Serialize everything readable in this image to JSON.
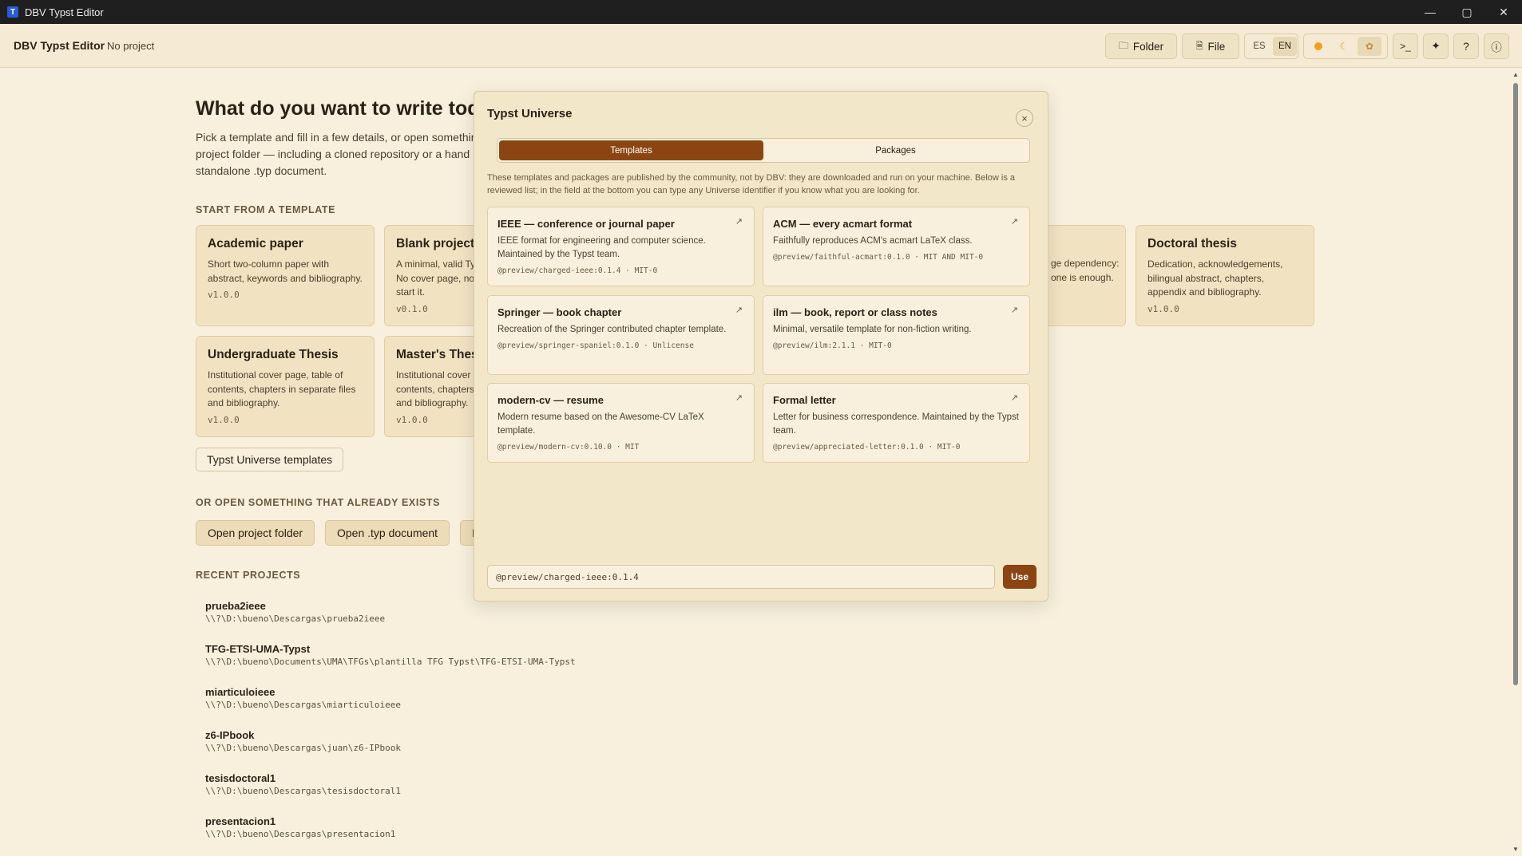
{
  "window": {
    "title": "DBV Typst Editor",
    "icon_letter": "T",
    "controls": [
      "minimize-icon",
      "maximize-icon",
      "close-icon"
    ]
  },
  "header": {
    "brand": "DBV Typst Editor",
    "project": "No project",
    "folder_label": "Folder",
    "file_label": "File",
    "lang": {
      "es": "ES",
      "en": "EN",
      "active": "EN"
    },
    "themes": [
      "sun-icon",
      "moon-icon",
      "scroll-icon"
    ],
    "terminal_label": ">_",
    "sparkle_label": "✦",
    "help_label": "?",
    "info_label": "ⓘ"
  },
  "main": {
    "title": "What do you want to write tod",
    "description": "Pick a template and fill in a few details, or open somethin project folder — including a cloned repository or a hand standalone .typ document.",
    "desc_lines": [
      "Pick a template and fill in a few details, or open somethin",
      "project folder — including a cloned repository or a hand",
      "standalone .typ document."
    ],
    "template_section": "START FROM A TEMPLATE",
    "templates": [
      {
        "name": "Academic paper",
        "desc": "Short two-column paper with abstract, keywords and bibliography.",
        "version": "v1.0.0"
      },
      {
        "name": "Blank project",
        "desc": "A minimal, valid Ty No cover page, no start it.",
        "version": "v0.1.0"
      },
      {
        "name": "",
        "desc": "ge dependency: one is enough.",
        "version": ""
      },
      {
        "name": "Doctoral thesis",
        "desc": "Dedication, acknowledgements, bilingual abstract, chapters, appendix and bibliography.",
        "version": "v1.0.0"
      },
      {
        "name": "Undergraduate Thesis",
        "desc": "Institutional cover page, table of contents, chapters in separate files and bibliography.",
        "version": "v1.0.0"
      },
      {
        "name": "Master's Thesi",
        "desc": "Institutional cover contents, chapters and bibliography.",
        "version": "v1.0.0"
      }
    ],
    "universe_button": "Typst Universe templates",
    "open_section": "OR OPEN SOMETHING THAT ALREADY EXISTS",
    "open_folder": "Open project folder",
    "open_typ": "Open .typ document",
    "open_third": "I",
    "recent_section": "RECENT PROJECTS",
    "recent": [
      {
        "name": "prueba2ieee",
        "path": "\\\\?\\D:\\bueno\\Descargas\\prueba2ieee"
      },
      {
        "name": "TFG-ETSI-UMA-Typst",
        "path": "\\\\?\\D:\\bueno\\Documents\\UMA\\TFGs\\plantilla TFG Typst\\TFG-ETSI-UMA-Typst"
      },
      {
        "name": "miarticuloieee",
        "path": "\\\\?\\D:\\bueno\\Descargas\\miarticuloieee"
      },
      {
        "name": "z6-IPbook",
        "path": "\\\\?\\D:\\bueno\\Descargas\\juan\\z6-IPbook"
      },
      {
        "name": "tesisdoctoral1",
        "path": "\\\\?\\D:\\bueno\\Descargas\\tesisdoctoral1"
      },
      {
        "name": "presentacion1",
        "path": "\\\\?\\D:\\bueno\\Descargas\\presentacion1"
      }
    ]
  },
  "modal": {
    "title": "Typst Universe",
    "close": "×",
    "tabs": [
      {
        "label": "Templates",
        "active": true
      },
      {
        "label": "Packages",
        "active": false
      }
    ],
    "note": "These templates and packages are published by the community, not by DBV: they are downloaded and run on your machine. Below is a reviewed list; in the field at the bottom you can type any Universe identifier if you know what you are looking for.",
    "items": [
      {
        "name": "IEEE — conference or journal paper",
        "desc": "IEEE format for engineering and computer science. Maintained by the Typst team.",
        "meta": "@preview/charged-ieee:0.1.4 · MIT-0"
      },
      {
        "name": "ACM — every acmart format",
        "desc": "Faithfully reproduces ACM's acmart LaTeX class.",
        "meta": "@preview/faithful-acmart:0.1.0 · MIT AND MIT-0"
      },
      {
        "name": "Springer — book chapter",
        "desc": "Recreation of the Springer contributed chapter template.",
        "meta": "@preview/springer-spaniel:0.1.0 · Unlicense"
      },
      {
        "name": "ilm — book, report or class notes",
        "desc": "Minimal, versatile template for non-fiction writing.",
        "meta": "@preview/ilm:2.1.1 · MIT-0"
      },
      {
        "name": "modern-cv — resume",
        "desc": "Modern resume based on the Awesome-CV LaTeX template.",
        "meta": "@preview/modern-cv:0.10.0 · MIT"
      },
      {
        "name": "Formal letter",
        "desc": "Letter for business correspondence. Maintained by the Typst team.",
        "meta": "@preview/appreciated-letter:0.1.0 · MIT-0"
      }
    ],
    "ext_glyph": "↗",
    "input_value": "@preview/charged-ieee:0.1.4",
    "use_label": "Use"
  },
  "colors": {
    "accent": "#8b4513",
    "background": "#f8f0dd",
    "card": "#f1e3c2",
    "titlebar": "#1f1f1f"
  }
}
